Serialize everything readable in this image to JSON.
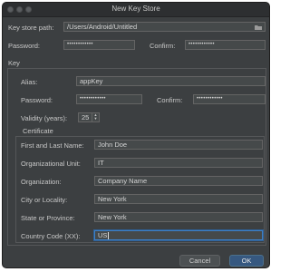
{
  "window": {
    "title": "New Key Store"
  },
  "keystore": {
    "path_label": "Key store path:",
    "path_value": "/Users/Android/Untitled",
    "password_label": "Password:",
    "password_value": "••••••••••••",
    "confirm_label": "Confirm:",
    "confirm_value": "••••••••••••"
  },
  "key": {
    "section_label": "Key",
    "alias_label": "Alias:",
    "alias_value": "appKey",
    "password_label": "Password:",
    "password_value": "••••••••••••",
    "confirm_label": "Confirm:",
    "confirm_value": "••••••••••••",
    "validity_label": "Validity (years):",
    "validity_value": "25"
  },
  "certificate": {
    "section_label": "Certificate",
    "fields": [
      {
        "label": "First and Last Name:",
        "value": "John Doe"
      },
      {
        "label": "Organizational Unit:",
        "value": "IT"
      },
      {
        "label": "Organization:",
        "value": "Company Name"
      },
      {
        "label": "City or Locality:",
        "value": "New York"
      },
      {
        "label": "State or Province:",
        "value": "New York"
      },
      {
        "label": "Country Code (XX):",
        "value": "US"
      }
    ]
  },
  "buttons": {
    "cancel": "Cancel",
    "ok": "OK"
  },
  "icons": {
    "folder": "folder-icon",
    "spinner": "spinner-arrows-icon"
  }
}
